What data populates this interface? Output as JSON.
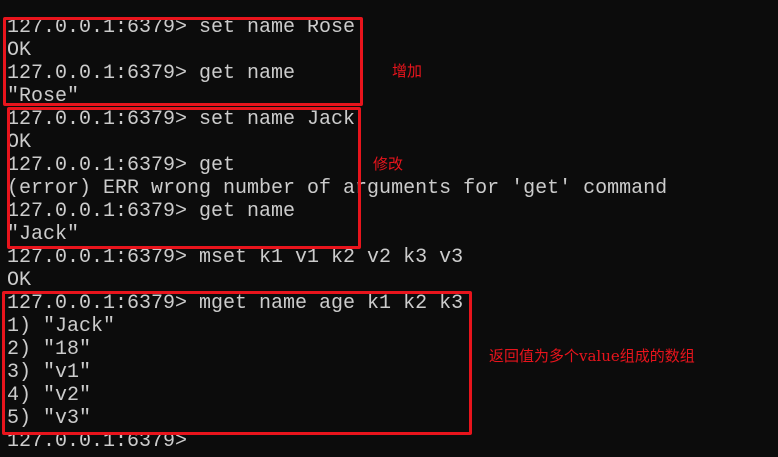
{
  "terminal": {
    "lines": [
      "127.0.0.1:6379> set name Rose",
      "OK",
      "127.0.0.1:6379> get name",
      "\"Rose\"",
      "127.0.0.1:6379> set name Jack",
      "OK",
      "127.0.0.1:6379> get",
      "(error) ERR wrong number of arguments for 'get' command",
      "127.0.0.1:6379> get name",
      "\"Jack\"",
      "127.0.0.1:6379> mset k1 v1 k2 v2 k3 v3",
      "OK",
      "127.0.0.1:6379> mget name age k1 k2 k3",
      "1) \"Jack\"",
      "2) \"18\"",
      "3) \"v1\"",
      "4) \"v2\"",
      "5) \"v3\"",
      "127.0.0.1:6379> "
    ]
  },
  "annotations": {
    "add": "增加",
    "modify": "修改",
    "mget_note": "返回值为多个value组成的数组"
  },
  "colors": {
    "annotation": "#e8141c",
    "background": "#0c0c0c",
    "text": "#cccccc"
  }
}
